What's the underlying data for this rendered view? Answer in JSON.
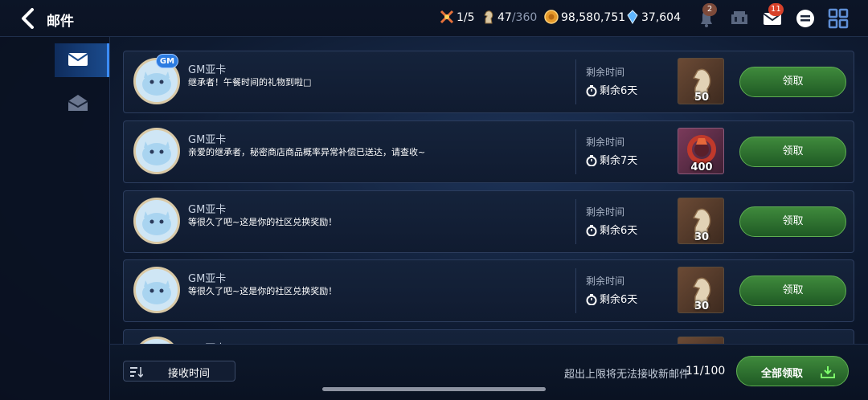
{
  "header": {
    "title": "邮件",
    "stamina": "1/5",
    "keys_current": "47",
    "keys_max": "/360",
    "gold": "98,580,751",
    "crystals": "37,604",
    "notice_badge": "2",
    "mail_badge": "11"
  },
  "sidebar": {
    "items": [
      {
        "name": "inbox",
        "active": true
      },
      {
        "name": "opened-mail",
        "active": false
      }
    ]
  },
  "mails": [
    {
      "sender": "GM亚卡",
      "gm": "GM",
      "message": "继承者！午餐时间的礼物到啦□",
      "remain_label": "剩余时间",
      "remain": "剩余6天",
      "item": "ore",
      "qty": "50",
      "claim": "领取"
    },
    {
      "sender": "GM亚卡",
      "message": "亲爱的继承者，秘密商店商品概率异常补偿已送达，请查收~",
      "remain_label": "剩余时间",
      "remain": "剩余7天",
      "item": "ring",
      "qty": "400",
      "claim": "领取"
    },
    {
      "sender": "GM亚卡",
      "message": "等很久了吧~这是你的社区兑换奖励！",
      "remain_label": "剩余时间",
      "remain": "剩余6天",
      "item": "ore",
      "qty": "30",
      "claim": "领取"
    },
    {
      "sender": "GM亚卡",
      "message": "等很久了吧~这是你的社区兑换奖励！",
      "remain_label": "剩余时间",
      "remain": "剩余6天",
      "item": "ore",
      "qty": "30",
      "claim": "领取"
    },
    {
      "sender": "GM亚卡"
    }
  ],
  "footer": {
    "sort_label": "接收时间",
    "limit_text": "超出上限将无法接收新邮件",
    "count": "11/100",
    "claim_all": "全部领取"
  },
  "colors": {
    "claim_green": "#2f7a2e",
    "accent_blue": "#3b8cff",
    "badge_red": "#d7412a"
  }
}
